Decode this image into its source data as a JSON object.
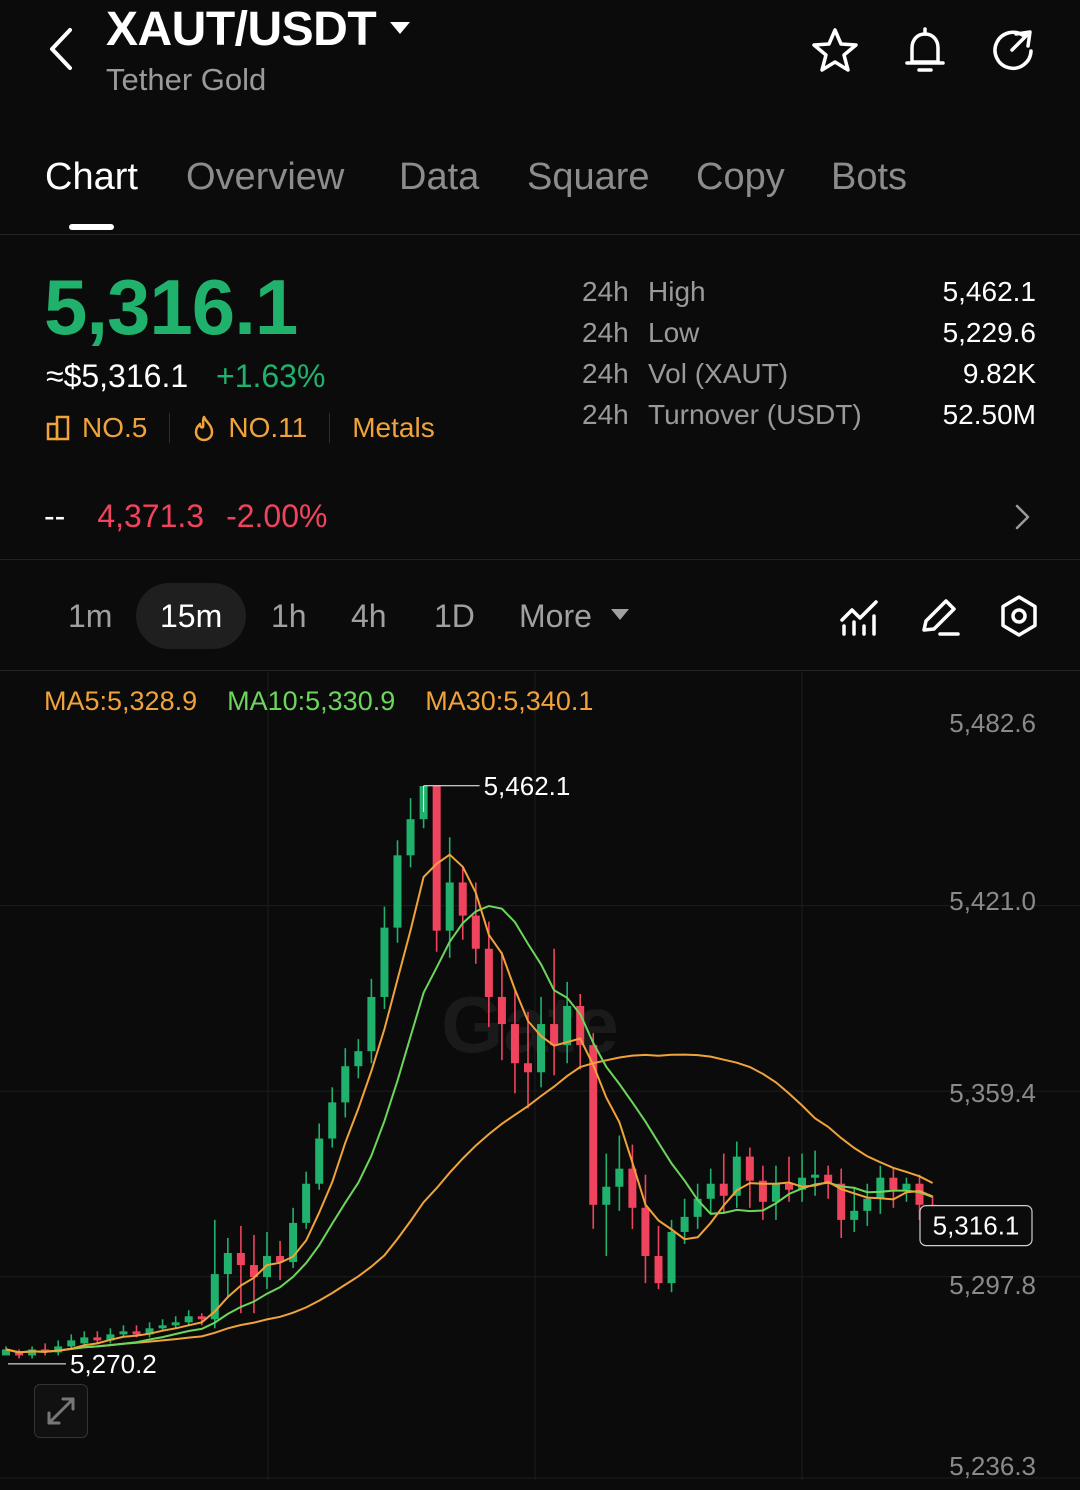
{
  "header": {
    "pair": "XAUT/USDT",
    "name": "Tether Gold",
    "icons": [
      "back-chevron-icon",
      "dropdown-caret-icon",
      "star-icon",
      "bell-icon",
      "share-icon"
    ]
  },
  "tabs": [
    "Chart",
    "Overview",
    "Data",
    "Square",
    "Copy",
    "Bots"
  ],
  "active_tab": "Chart",
  "ticker": {
    "last_price": "5,316.1",
    "approx_usd": "≈$5,316.1",
    "change_pct": "+1.63%",
    "rank_1": "NO.5",
    "rank_2": "NO.11",
    "category": "Metals",
    "stats": [
      {
        "period": "24h",
        "label": "High",
        "value": "5,462.1"
      },
      {
        "period": "24h",
        "label": "Low",
        "value": "5,229.6"
      },
      {
        "period": "24h",
        "label": "Vol (XAUT)",
        "value": "9.82K"
      },
      {
        "period": "24h",
        "label": "Turnover (USDT)",
        "value": "52.50M"
      }
    ]
  },
  "secondary": {
    "dash": "--",
    "price": "4,371.3",
    "change": "-2.00%"
  },
  "intervals": [
    "1m",
    "15m",
    "1h",
    "4h",
    "1D",
    "More"
  ],
  "active_interval": "15m",
  "toolbar_icons": [
    "indicators-icon",
    "draw-pen-icon",
    "settings-hexagon-icon"
  ],
  "colors": {
    "up": "#20b26c",
    "down": "#f0435e",
    "accent": "#f0a33a",
    "ma5": "#f0a33a",
    "ma10": "#6cd65c",
    "ma30": "#f0a33a"
  },
  "chart": {
    "ma5": "MA5:5,328.9",
    "ma10": "MA10:5,330.9",
    "ma30": "MA30:5,340.1",
    "y_ticks": [
      "5,482.6",
      "5,421.0",
      "5,359.4",
      "5,297.8",
      "5,236.3"
    ],
    "high_label": "5,462.1",
    "low_label": "5,270.2",
    "last_label": "5,316.1",
    "watermark": "Gate"
  },
  "chart_data": {
    "type": "candlestick",
    "interval": "15m",
    "ylim": [
      5236.3,
      5482.6
    ],
    "y_ticks": [
      5482.6,
      5421.0,
      5359.4,
      5297.8,
      5236.3
    ],
    "last_price": 5316.1,
    "annotated_high": 5462.1,
    "annotated_low": 5270.2,
    "series_values": [
      {
        "name": "MA5",
        "value": 5328.9
      },
      {
        "name": "MA10",
        "value": 5330.9
      },
      {
        "name": "MA30",
        "value": 5340.1
      }
    ],
    "candles": [
      [
        5273,
        5275,
        5274,
        5276
      ],
      [
        5274,
        5273,
        5272,
        5275
      ],
      [
        5273,
        5275,
        5272,
        5276
      ],
      [
        5275,
        5274,
        5273,
        5277
      ],
      [
        5274,
        5276,
        5273,
        5278
      ],
      [
        5276,
        5278,
        5275,
        5280
      ],
      [
        5277,
        5279,
        5276,
        5281
      ],
      [
        5279,
        5278,
        5277,
        5281
      ],
      [
        5278,
        5280,
        5277,
        5282
      ],
      [
        5280,
        5281,
        5279,
        5283
      ],
      [
        5281,
        5280,
        5279,
        5283
      ],
      [
        5280,
        5282,
        5279,
        5284
      ],
      [
        5282,
        5283,
        5281,
        5285
      ],
      [
        5283,
        5284,
        5282,
        5286
      ],
      [
        5284,
        5286,
        5283,
        5288
      ],
      [
        5286,
        5285,
        5283,
        5287
      ],
      [
        5285,
        5300,
        5282,
        5318
      ],
      [
        5300,
        5307,
        5292,
        5312
      ],
      [
        5307,
        5303,
        5287,
        5316
      ],
      [
        5303,
        5299,
        5287,
        5313
      ],
      [
        5299,
        5306,
        5295,
        5314
      ],
      [
        5306,
        5304,
        5298,
        5311
      ],
      [
        5304,
        5317,
        5302,
        5322
      ],
      [
        5317,
        5330,
        5315,
        5334
      ],
      [
        5330,
        5345,
        5328,
        5350
      ],
      [
        5345,
        5357,
        5342,
        5362
      ],
      [
        5357,
        5369,
        5352,
        5375
      ],
      [
        5369,
        5374,
        5365,
        5378
      ],
      [
        5374,
        5392,
        5370,
        5398
      ],
      [
        5392,
        5415,
        5388,
        5422
      ],
      [
        5415,
        5439,
        5410,
        5444
      ],
      [
        5439,
        5451,
        5435,
        5458
      ],
      [
        5451,
        5462,
        5448,
        5462
      ],
      [
        5462,
        5414,
        5407,
        5462
      ],
      [
        5414,
        5430,
        5405,
        5445
      ],
      [
        5430,
        5419,
        5411,
        5435
      ],
      [
        5419,
        5408,
        5403,
        5430
      ],
      [
        5408,
        5392,
        5382,
        5417
      ],
      [
        5392,
        5383,
        5371,
        5407
      ],
      [
        5383,
        5370,
        5360,
        5394
      ],
      [
        5370,
        5367,
        5355,
        5387
      ],
      [
        5367,
        5383,
        5362,
        5392
      ],
      [
        5383,
        5376,
        5366,
        5408
      ],
      [
        5376,
        5389,
        5370,
        5397
      ],
      [
        5389,
        5376,
        5368,
        5393
      ],
      [
        5376,
        5323,
        5315,
        5380
      ],
      [
        5323,
        5329,
        5306,
        5340
      ],
      [
        5329,
        5335,
        5321,
        5346
      ],
      [
        5335,
        5322,
        5315,
        5343
      ],
      [
        5322,
        5306,
        5297,
        5333
      ],
      [
        5306,
        5297,
        5295,
        5316
      ],
      [
        5297,
        5314,
        5294,
        5318
      ],
      [
        5314,
        5319,
        5310,
        5325
      ],
      [
        5319,
        5325,
        5315,
        5330
      ],
      [
        5325,
        5330,
        5320,
        5335
      ],
      [
        5330,
        5326,
        5320,
        5340
      ],
      [
        5326,
        5339,
        5322,
        5344
      ],
      [
        5339,
        5331,
        5322,
        5342
      ],
      [
        5331,
        5324,
        5318,
        5336
      ],
      [
        5324,
        5330,
        5318,
        5336
      ],
      [
        5330,
        5328,
        5324,
        5339
      ],
      [
        5328,
        5332,
        5324,
        5340
      ],
      [
        5332,
        5333,
        5326,
        5341
      ],
      [
        5333,
        5330,
        5325,
        5336
      ],
      [
        5330,
        5318,
        5312,
        5335
      ],
      [
        5318,
        5321,
        5314,
        5329
      ],
      [
        5321,
        5325,
        5316,
        5330
      ],
      [
        5325,
        5332,
        5320,
        5336
      ],
      [
        5332,
        5328,
        5322,
        5335
      ],
      [
        5328,
        5330,
        5324,
        5332
      ],
      [
        5330,
        5323,
        5318,
        5333
      ],
      [
        5323,
        5316,
        5314,
        5326
      ]
    ]
  }
}
